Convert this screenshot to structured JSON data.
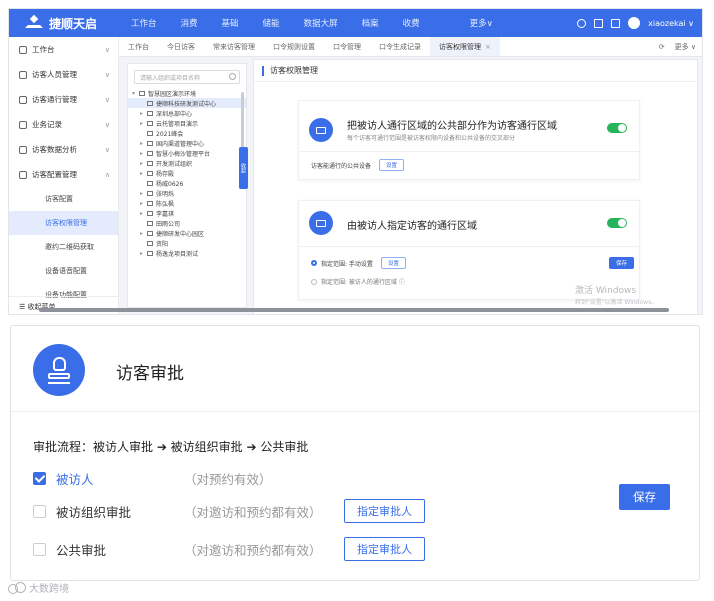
{
  "app": {
    "brand": "捷顺天启",
    "top_nav": [
      "工作台",
      "消费",
      "基础",
      "储能",
      "数据大屏",
      "档案",
      "收费",
      "更多∨"
    ],
    "user": "xiaozekai ∨"
  },
  "sidebar": {
    "items": [
      {
        "label": "工作台",
        "icon": "dashboard-icon"
      },
      {
        "label": "访客人员管理",
        "icon": "people-icon"
      },
      {
        "label": "访客通行管理",
        "icon": "send-icon"
      },
      {
        "label": "业务记录",
        "icon": "record-icon"
      },
      {
        "label": "访客数据分析",
        "icon": "chart-icon"
      },
      {
        "label": "访客配置管理",
        "icon": "config-icon"
      }
    ],
    "subitems": [
      "访客配置",
      "访客权限管理",
      "邀约二维码获取",
      "设备语音配置",
      "设备功能配置"
    ],
    "active_sub": "访客权限管理",
    "collapse_label": "收起菜单"
  },
  "tabs": {
    "items": [
      "工作台",
      "今日访客",
      "常来访客管理",
      "口令规则设置",
      "口令管理",
      "口令生成记录",
      "访客权限管理"
    ],
    "active": "访客权限管理",
    "more": "更多 ∨"
  },
  "tree": {
    "search_placeholder": "请输入组织或项目名称",
    "nodes": [
      "智慧园区演示环境",
      "捷顺科技研发测试中心",
      "深圳总部中心",
      "云托管项目演示",
      "2021峰会",
      "国内渠道管理中心",
      "智慧小梅沙管理平台",
      "开发测试组织",
      "杨存殿",
      "杨威0626",
      "张明烁",
      "陈弘枫",
      "李嘉琪",
      "田雨公司",
      "捷顺研发中心园区",
      "资阳",
      "杨逸龙项目测试"
    ],
    "fold_label": "收起"
  },
  "main": {
    "title": "访客权限管理",
    "card1": {
      "title": "把被访人通行区域的公共部分作为访客通行区域",
      "subtitle": "每个访客可通行范围是被访客权限内设备和公共设备的交叉部分",
      "row_label": "访客能通行的公共设备",
      "row_button": "设置"
    },
    "card2": {
      "title": "由被访人指定访客的通行区域",
      "option1": "指定范围: 手动设置",
      "option1_button": "设置",
      "option2": "指定范围: 被访人的通行区域 ⓘ",
      "save_button": "保存"
    },
    "watermark_line1": "激活 Windows",
    "watermark_line2": "转到\"设置\"以激活 Windows。"
  },
  "approval": {
    "title": "访客审批",
    "flow": "审批流程：被访人审批 ➔ 被访组织审批 ➔ 公共审批",
    "options": [
      {
        "label": "被访人",
        "note": "（对预约有效）",
        "checked": true,
        "button": ""
      },
      {
        "label": "被访组织审批",
        "note": "（对邀访和预约都有效）",
        "checked": false,
        "button": "指定审批人"
      },
      {
        "label": "公共审批",
        "note": "（对邀访和预约都有效）",
        "checked": false,
        "button": "指定审批人"
      }
    ],
    "save_button": "保存"
  },
  "corner_watermark": "大数跨境",
  "colors": {
    "primary": "#3a6ee8",
    "toggle_on": "#26b35a"
  }
}
